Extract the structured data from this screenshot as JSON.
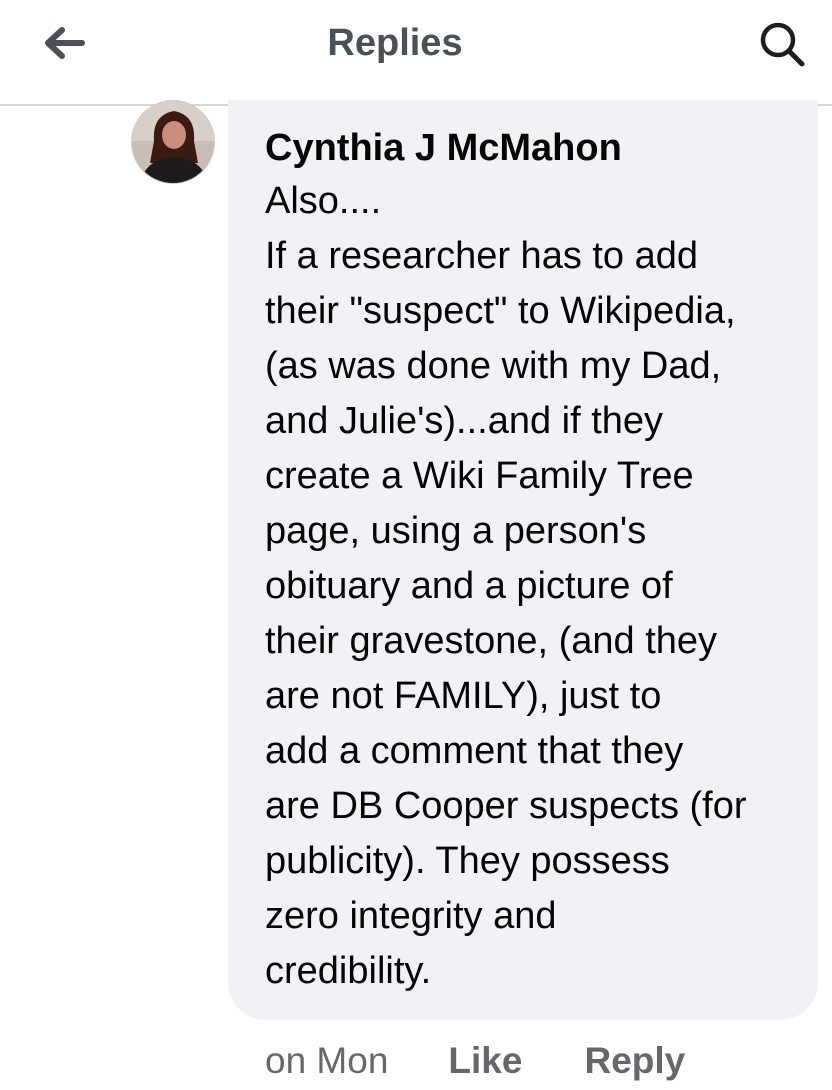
{
  "header": {
    "title": "Replies",
    "back_icon": "arrow-left-icon",
    "search_icon": "search-icon"
  },
  "comment": {
    "author": "Cynthia J McMahon",
    "text": "Also....\nIf a researcher has to add\ntheir \"suspect\" to Wikipedia,\n(as was done with my Dad,\nand Julie's)...and if they\ncreate a Wiki Family Tree\npage, using a person's\nobituary and a picture of\ntheir gravestone, (and they\nare not FAMILY), just to\nadd a comment that they\nare DB Cooper suspects (for\npublicity). They possess\nzero integrity and\ncredibility.",
    "timestamp": "on Mon",
    "like_label": "Like",
    "reply_label": "Reply"
  },
  "colors": {
    "header_text": "#4b4f56",
    "bubble_bg": "#f0f2f5",
    "meta_text": "#65676b"
  }
}
